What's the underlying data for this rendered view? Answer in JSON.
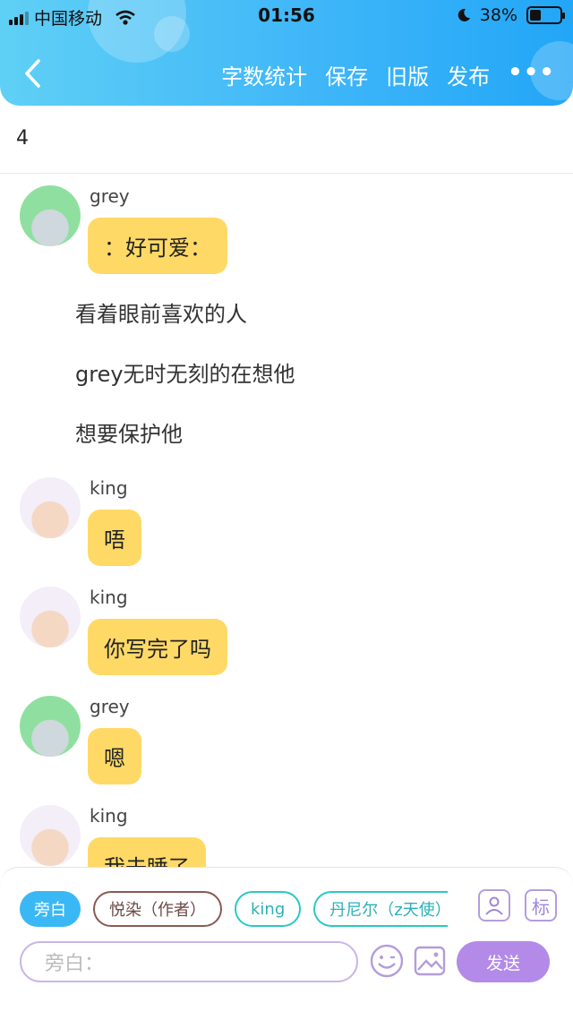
{
  "status_bar": {
    "carrier": "中国移动",
    "time": "01:56",
    "battery": "38%",
    "battery_level": 0.38
  },
  "nav": {
    "back_icon": "chevron-left-icon",
    "actions": [
      "字数统计",
      "保存",
      "旧版",
      "发布"
    ],
    "more_icon": "more-dots-icon"
  },
  "doc": {
    "title": "4"
  },
  "messages": [
    {
      "speaker": "grey",
      "text": "：好可爱："
    },
    {
      "narration": "看着眼前喜欢的人"
    },
    {
      "narration": "grey无时无刻的在想他"
    },
    {
      "narration": "想要保护他"
    },
    {
      "speaker": "king",
      "text": "唔"
    },
    {
      "speaker": "king",
      "text": "你写完了吗"
    },
    {
      "speaker": "grey",
      "text": "嗯"
    },
    {
      "speaker": "king",
      "text": "我去睡了"
    }
  ],
  "composer": {
    "roles": [
      "旁白",
      "悦染（作者）",
      "king",
      "丹尼尔（z天使）"
    ],
    "active_role": "旁白",
    "mark_label": "标",
    "input_placeholder": "旁白：",
    "send_label": "发送",
    "icons": [
      "person-manage-icon",
      "emoji-icon",
      "image-icon"
    ]
  },
  "colors": {
    "header_gradient": [
      "#5fd0f5",
      "#22a6f7"
    ],
    "bubble": "#ffd966",
    "send": "#b38ae8",
    "accent_purple": "#b39ddb"
  }
}
